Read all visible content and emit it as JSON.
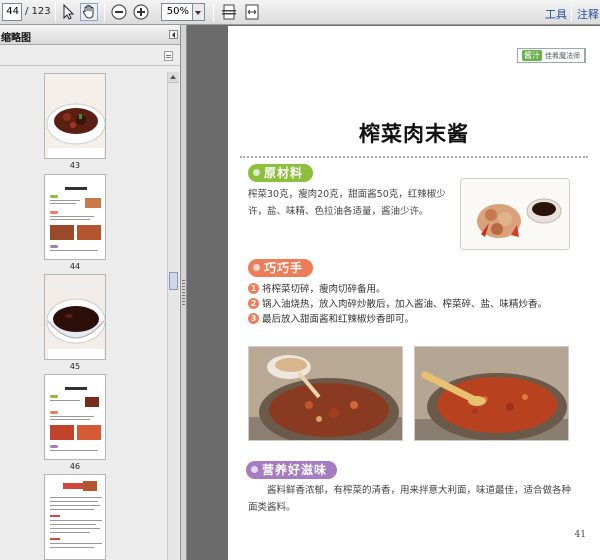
{
  "toolbar": {
    "page_current": "44",
    "page_total": "/ 123",
    "zoom": "50%",
    "tools_label": "工具",
    "comment_label": "注释"
  },
  "sidebar": {
    "title": "缩略图",
    "thumbnails": [
      {
        "page": "43"
      },
      {
        "page": "44"
      },
      {
        "page": "45"
      },
      {
        "page": "46"
      }
    ]
  },
  "document": {
    "corner_tag_badge": "酱汁",
    "corner_tag_text": "佳肴魔法师",
    "title": "榨菜肉末酱",
    "ingredients_heading": "原材料",
    "ingredients": "榨菜30克，瘦肉20克，甜面酱50克，红辣椒少许，盐、味精、色拉油各适量，酱油少许。",
    "tips_heading": "巧巧手",
    "steps": [
      {
        "num": "1",
        "text": "将榨菜切碎，瘦肉切碎备用。"
      },
      {
        "num": "2",
        "text": "锅入油烧热，放入肉碎炒散后，加入酱油、榨菜碎、盐、味精炒香。"
      },
      {
        "num": "3",
        "text": "最后放入甜面酱和红辣椒炒香即可。"
      }
    ],
    "nutrition_heading": "营养好滋味",
    "nutrition": "酱料鲜香浓郁，有榨菜的清香，用来拌意大利面，味道最佳，适合做各种面类酱料。",
    "page_number": "41"
  },
  "colors": {
    "ingredients_pill": "#8bbf3c",
    "tips_pill": "#f07d5a",
    "nutrition_pill": "#a57cc2",
    "link": "#1f4f9c"
  }
}
